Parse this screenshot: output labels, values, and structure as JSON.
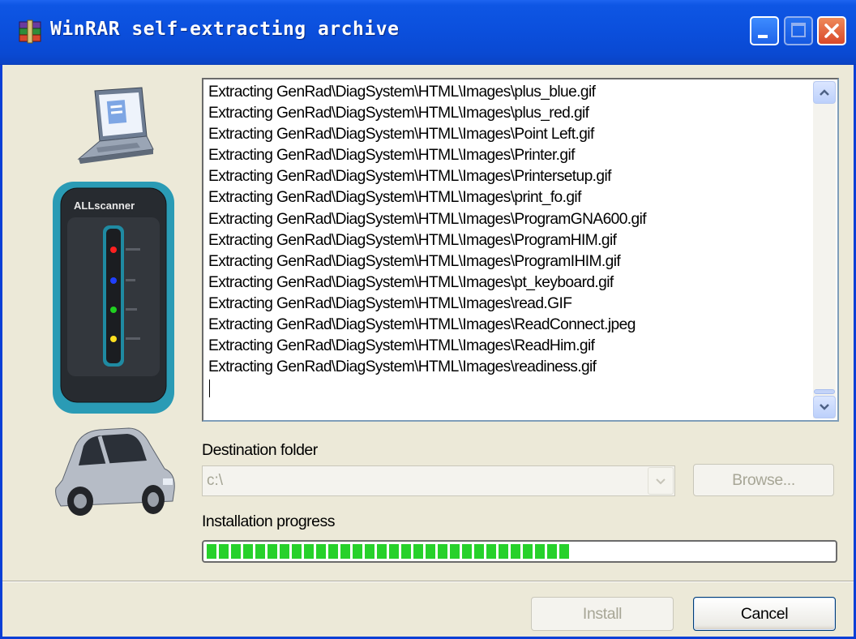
{
  "window": {
    "title": "WinRAR self-extracting archive"
  },
  "title_buttons": {
    "minimize_icon": "minimize-icon",
    "maximize_icon": "maximize-icon",
    "close_icon": "close-icon"
  },
  "log": {
    "lines": [
      "Extracting GenRad\\DiagSystem\\HTML\\Images\\plus_blue.gif",
      "Extracting GenRad\\DiagSystem\\HTML\\Images\\plus_red.gif",
      "Extracting GenRad\\DiagSystem\\HTML\\Images\\Point Left.gif",
      "Extracting GenRad\\DiagSystem\\HTML\\Images\\Printer.gif",
      "Extracting GenRad\\DiagSystem\\HTML\\Images\\Printersetup.gif",
      "Extracting GenRad\\DiagSystem\\HTML\\Images\\print_fo.gif",
      "Extracting GenRad\\DiagSystem\\HTML\\Images\\ProgramGNA600.gif",
      "Extracting GenRad\\DiagSystem\\HTML\\Images\\ProgramHIM.gif",
      "Extracting GenRad\\DiagSystem\\HTML\\Images\\ProgramIHIM.gif",
      "Extracting GenRad\\DiagSystem\\HTML\\Images\\pt_keyboard.gif",
      "Extracting GenRad\\DiagSystem\\HTML\\Images\\read.GIF",
      "Extracting GenRad\\DiagSystem\\HTML\\Images\\ReadConnect.jpeg",
      "Extracting GenRad\\DiagSystem\\HTML\\Images\\ReadHim.gif",
      "Extracting GenRad\\DiagSystem\\HTML\\Images\\readiness.gif"
    ]
  },
  "destination": {
    "label": "Destination folder",
    "value": "c:\\",
    "browse_label": "Browse..."
  },
  "progress": {
    "label": "Installation progress",
    "fraction": 0.595,
    "color": "#27d12b"
  },
  "buttons": {
    "install_label": "Install",
    "cancel_label": "Cancel"
  },
  "device": {
    "brand": "ALLscanner"
  },
  "colors": {
    "titlebar": "#0b4fdc",
    "dialog": "#ece9d8",
    "accent": "#003c74"
  }
}
